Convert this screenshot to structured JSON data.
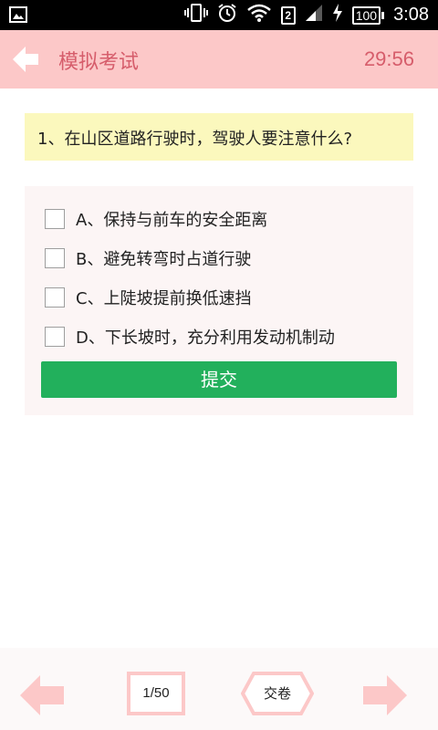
{
  "status_bar": {
    "time": "3:08",
    "sim_slot": "2",
    "battery": "100",
    "icons": [
      "image-icon",
      "vibrate-icon",
      "alarm-icon",
      "wifi-icon",
      "sim-icon",
      "signal-icon",
      "charging-icon",
      "battery-icon"
    ]
  },
  "app_bar": {
    "title": "模拟考试",
    "timer": "29:56",
    "back_icon": "back-arrow-icon"
  },
  "question": {
    "text": "1、在山区道路行驶时，驾驶人要注意什么?"
  },
  "options": [
    {
      "label": "A、保持与前车的安全距离",
      "checked": false
    },
    {
      "label": "B、避免转弯时占道行驶",
      "checked": false
    },
    {
      "label": "C、上陡坡提前换低速挡",
      "checked": false
    },
    {
      "label": "D、下长坡时，充分利用发动机制动",
      "checked": false
    }
  ],
  "submit_label": "提交",
  "bottom_bar": {
    "page": "1/50",
    "hand_in_label": "交卷",
    "prev_icon": "arrow-left-icon",
    "next_icon": "arrow-right-icon"
  },
  "colors": {
    "app_bar_bg": "#fcc8c8",
    "accent_text": "#d65d6b",
    "question_bg": "#fbf8bd",
    "submit_bg": "#22b05c",
    "arrow_pink": "#fcc8c8"
  }
}
